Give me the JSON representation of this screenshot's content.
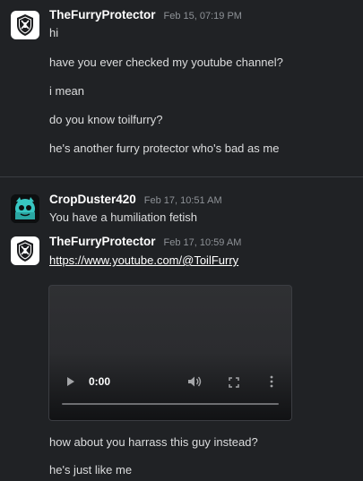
{
  "messages": [
    {
      "author": "TheFurryProtector",
      "timestamp": "Feb 15, 07:19 PM",
      "avatar": "shield-logo-avatar",
      "lines": [
        "hi",
        "have you ever checked my youtube channel?",
        "i mean",
        "do you know toilfurry?",
        "he's another furry protector who's bad as me"
      ]
    },
    {
      "author": "CropDuster420",
      "timestamp": "Feb 17, 10:51 AM",
      "avatar": "teal-character-avatar",
      "lines": [
        "You have a humiliation fetish"
      ]
    },
    {
      "author": "TheFurryProtector",
      "timestamp": "Feb 17, 10:59 AM",
      "avatar": "shield-logo-avatar",
      "link": "https://www.youtube.com/@ToilFurry",
      "video": {
        "time": "0:00"
      },
      "lines": [
        "how about you harrass this guy instead?",
        "he's just like me"
      ]
    }
  ],
  "colors": {
    "background": "#202225",
    "author": "#ffffff",
    "timestamp": "#8e9297",
    "text": "#dcddde",
    "accent_teal": "#38c7c2"
  }
}
